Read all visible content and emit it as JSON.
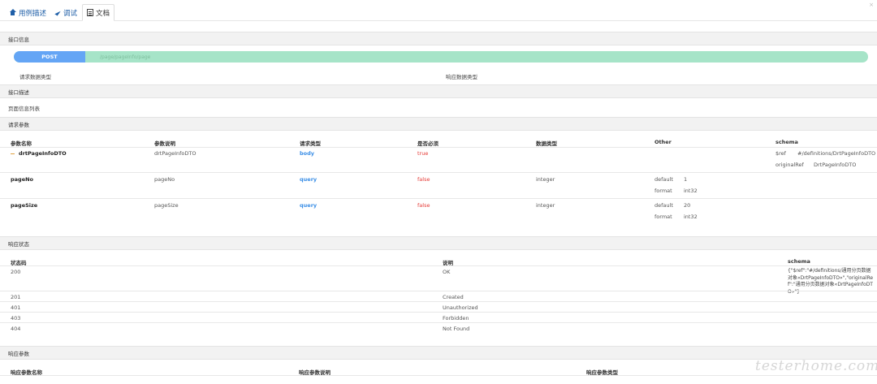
{
  "tabs": [
    {
      "label": "用例描述",
      "icon": "home-icon"
    },
    {
      "label": "调试",
      "icon": "send-icon"
    },
    {
      "label": "文档",
      "icon": "document-icon"
    }
  ],
  "close_label": "×",
  "interface_info": {
    "header": "接口信息",
    "method": "POST",
    "path": "/page/pageInfo/page",
    "request_type_label": "请求数据类型",
    "response_type_label": "响应数据类型"
  },
  "interface_desc": {
    "header": "接口描述",
    "text": "页面信息列表"
  },
  "request_params": {
    "header": "请求参数",
    "columns": [
      "参数名称",
      "参数说明",
      "请求类型",
      "是否必须",
      "数据类型",
      "Other",
      "schema"
    ],
    "rows": [
      {
        "name": "drtPageInfoDTO",
        "desc": "drtPageInfoDTO",
        "in": "body",
        "required": "true",
        "type": "",
        "other": [],
        "schema": [
          [
            "$ref",
            "#/definitions/DrtPageInfoDTO"
          ],
          [
            "originalRef",
            "DrtPageInfoDTO"
          ]
        ]
      },
      {
        "name": "pageNo",
        "desc": "pageNo",
        "in": "query",
        "required": "false",
        "type": "integer",
        "other": [
          [
            "default",
            "1"
          ],
          [
            "format",
            "int32"
          ]
        ],
        "schema": []
      },
      {
        "name": "pageSize",
        "desc": "pageSize",
        "in": "query",
        "required": "false",
        "type": "integer",
        "other": [
          [
            "default",
            "20"
          ],
          [
            "format",
            "int32"
          ]
        ],
        "schema": []
      }
    ]
  },
  "response_status": {
    "header": "响应状态",
    "columns": [
      "状态码",
      "说明",
      "schema"
    ],
    "rows": [
      {
        "code": "200",
        "desc": "OK",
        "schema": "{\"$ref\":\"#/definitions/通用分页数据对象«DrtPageInfoDTO»\",\"originalRef\":\"通用分页数据对象«DrtPageInfoDTO»\"}"
      },
      {
        "code": "201",
        "desc": "Created",
        "schema": ""
      },
      {
        "code": "401",
        "desc": "Unauthorized",
        "schema": ""
      },
      {
        "code": "403",
        "desc": "Forbidden",
        "schema": ""
      },
      {
        "code": "404",
        "desc": "Not Found",
        "schema": ""
      }
    ]
  },
  "response_params": {
    "header": "响应参数",
    "columns": [
      "响应参数名称",
      "响应参数说明",
      "响应参数类型"
    ]
  },
  "watermark": "testerhome.com"
}
